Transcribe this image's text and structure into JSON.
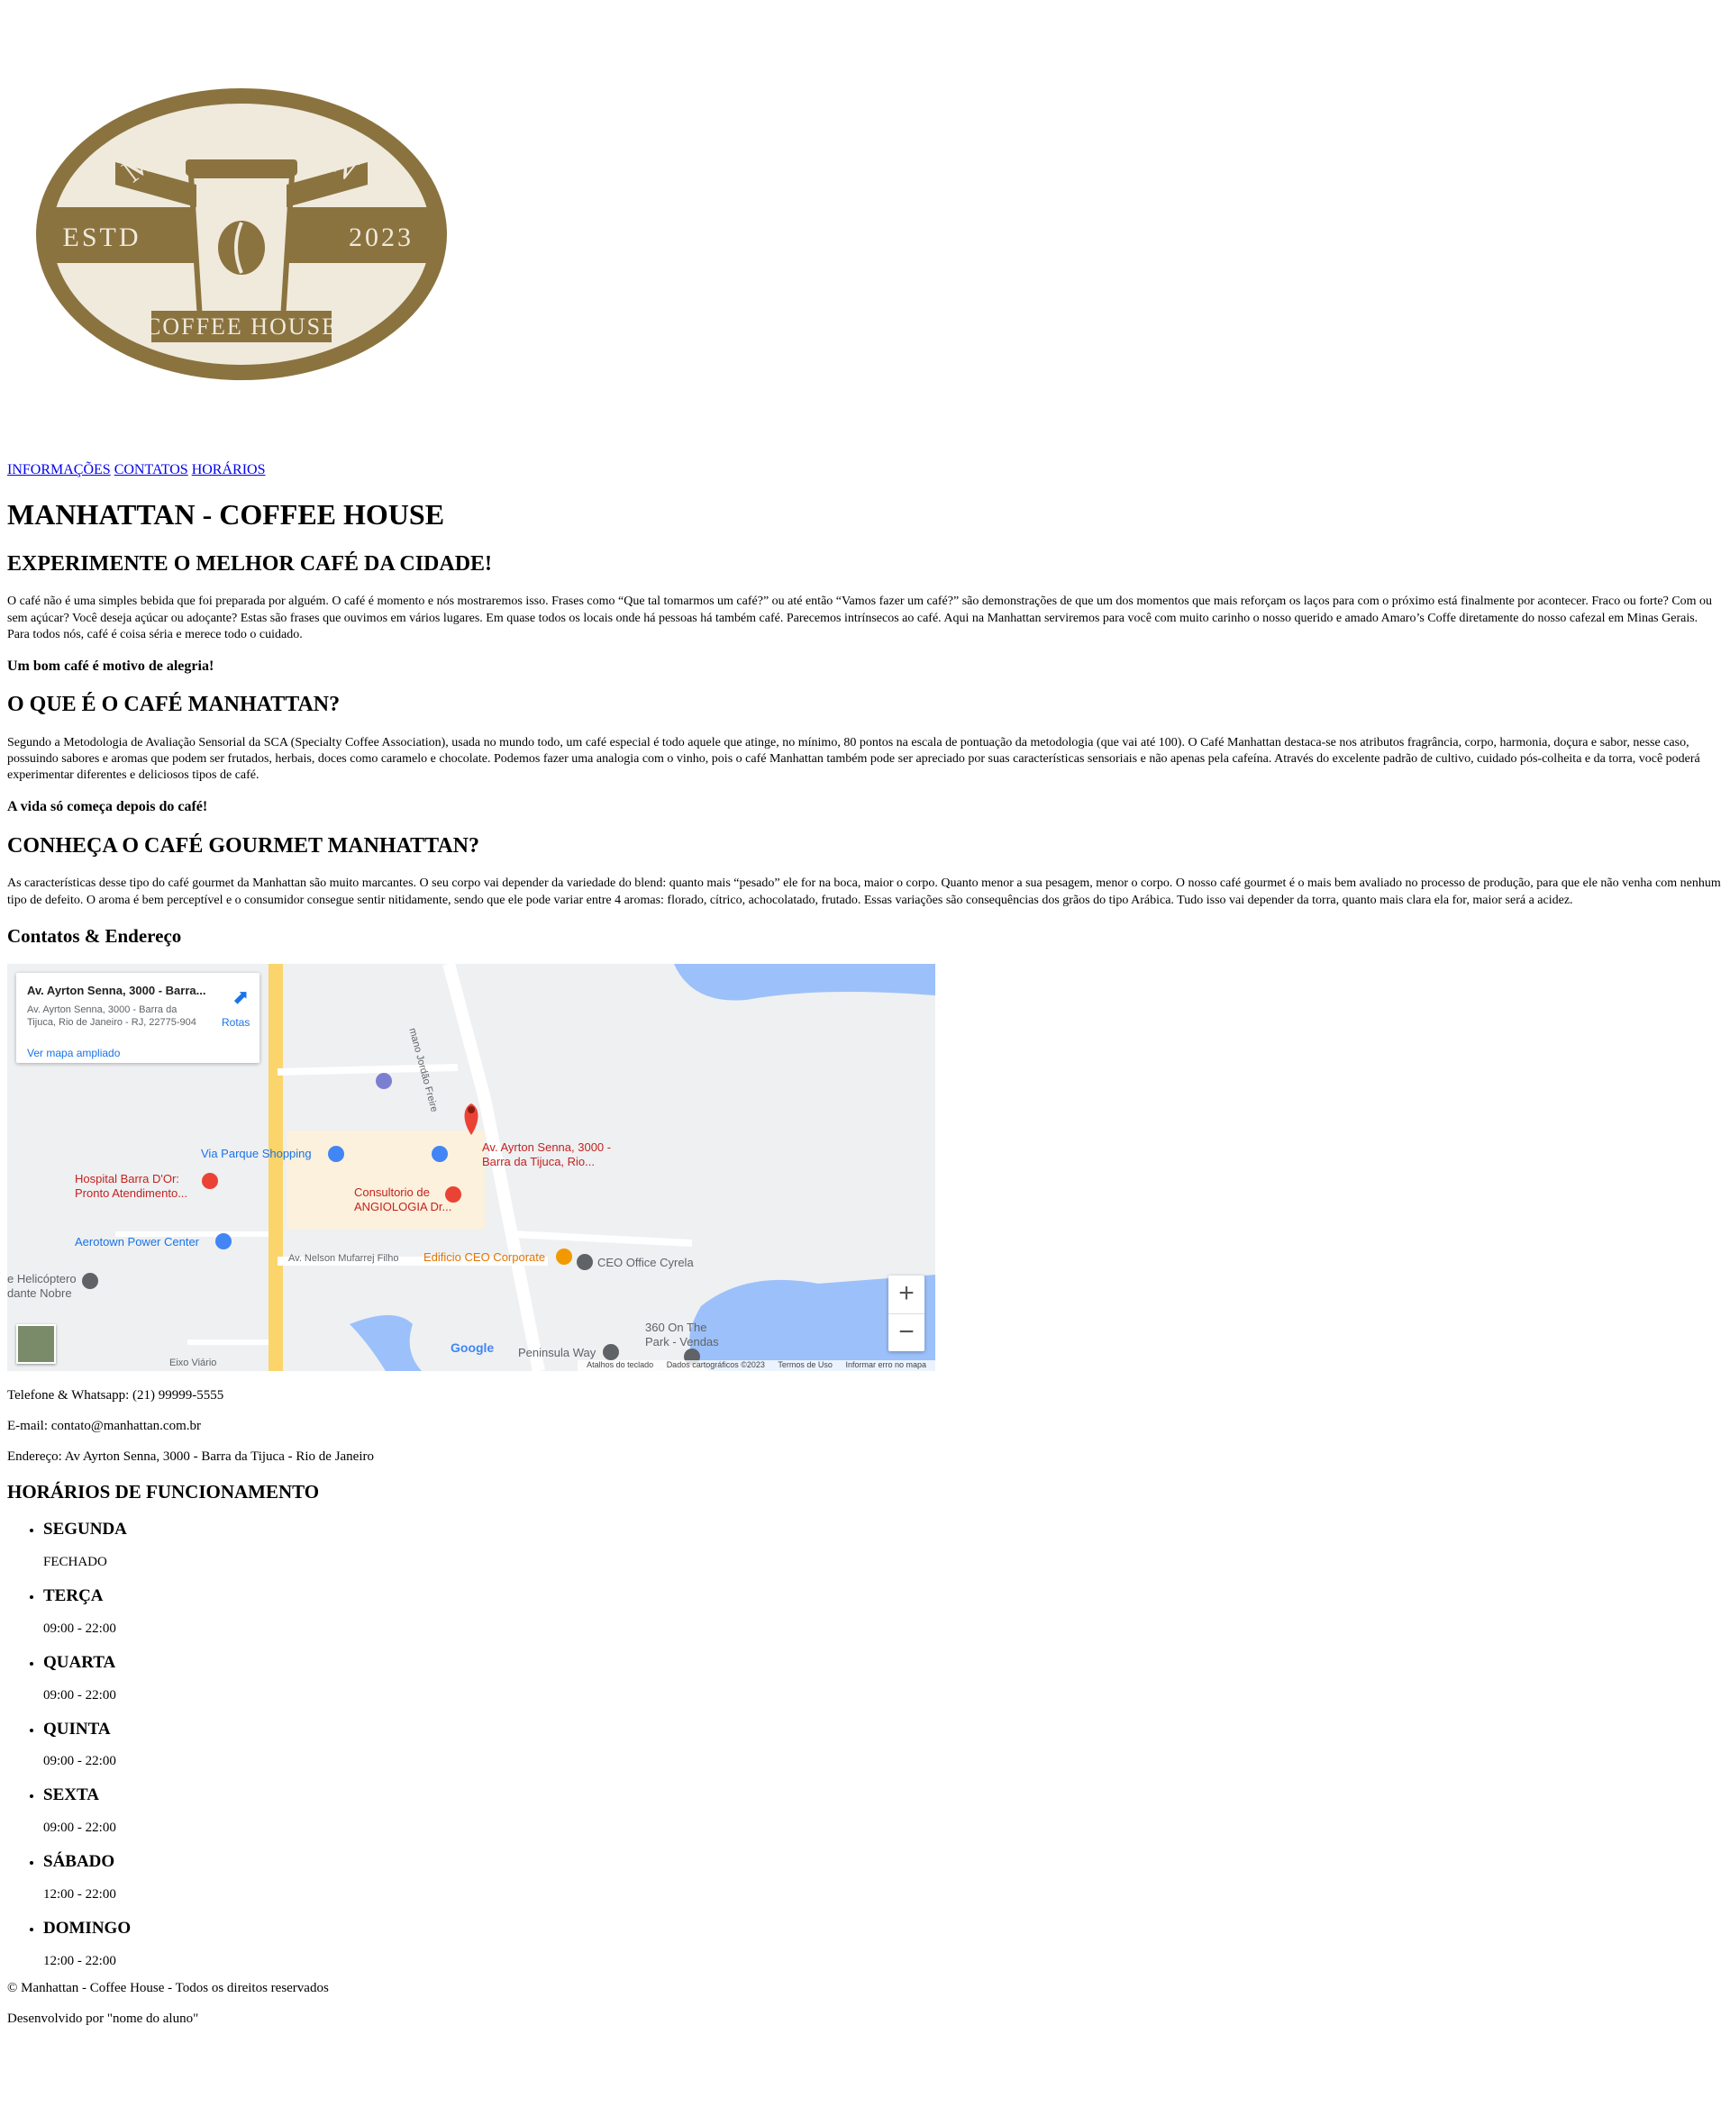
{
  "logo": {
    "top_text": "MANHATTAN",
    "left_text": "ESTD",
    "right_text": "2023",
    "bottom_text": "COFFEE HOUSE"
  },
  "nav": {
    "items": [
      "INFORMAÇÕES",
      "CONTATOS",
      "HORÁRIOS"
    ]
  },
  "main": {
    "title": "MANHATTAN - COFFEE HOUSE",
    "section1": {
      "heading": "EXPERIMENTE O MELHOR CAFÉ DA CIDADE!",
      "body": "O café não é uma simples bebida que foi preparada por alguém. O café é momento e nós mostraremos isso. Frases como “Que tal tomarmos um café?” ou até então “Vamos fazer um café?” são demonstrações de que um dos momentos que mais reforçam os laços para com o próximo está finalmente por acontecer. Fraco ou forte? Com ou sem açúcar? Você deseja açúcar ou adoçante? Estas são frases que ouvimos em vários lugares. Em quase todos os locais onde há pessoas há também café. Parecemos intrínsecos ao café. Aqui na Manhattan serviremos para você com muito carinho o nosso querido e amado Amaro’s Coffe diretamente do nosso cafezal em Minas Gerais. Para todos nós, café é coisa séria e merece todo o cuidado.",
      "tagline": "Um bom café é motivo de alegria!"
    },
    "section2": {
      "heading": "O QUE É O CAFÉ MANHATTAN?",
      "body": "Segundo a Metodologia de Avaliação Sensorial da SCA (Specialty Coffee Association), usada no mundo todo, um café especial é todo aquele que atinge, no mínimo, 80 pontos na escala de pontuação da metodologia (que vai até 100). O Café Manhattan destaca-se nos atributos fragrância, corpo, harmonia, doçura e sabor, nesse caso, possuindo sabores e aromas que podem ser frutados, herbais, doces como caramelo e chocolate. Podemos fazer uma analogia com o vinho, pois o café Manhattan também pode ser apreciado por suas características sensoriais e não apenas pela cafeína. Através do excelente padrão de cultivo, cuidado pós-colheita e da torra, você poderá experimentar diferentes e deliciosos tipos de café.",
      "tagline": "A vida só começa depois do café!"
    },
    "section3": {
      "heading": "CONHEÇA O CAFÉ GOURMET MANHATTAN?",
      "body": "As características desse tipo do café gourmet da Manhattan são muito marcantes. O seu corpo vai depender da variedade do blend: quanto mais “pesado” ele for na boca, maior o corpo. Quanto menor a sua pesagem, menor o corpo. O nosso café gourmet é o mais bem avaliado no processo de produção, para que ele não venha com nenhum tipo de defeito. O aroma é bem perceptível e o consumidor consegue sentir nitidamente, sendo que ele pode variar entre 4 aromas: florado, cítrico, achocolatado, frutado. Essas variações são consequências dos grãos do tipo Arábica. Tudo isso vai depender da torra, quanto mais clara ela for, maior será a acidez."
    }
  },
  "contacts": {
    "heading": "Contatos & Endereço",
    "map": {
      "card_title": "Av. Ayrton Senna, 3000 - Barra...",
      "card_address": "Av. Ayrton Senna, 3000 - Barra da Tijuca, Rio de Janeiro - RJ, 22775-904",
      "card_link": "Ver mapa ampliado",
      "directions": "Rotas",
      "pin_label": "Av. Ayrton Senna, 3000 - Barra da Tijuca, Rio...",
      "places": [
        "Via Parque Shopping",
        "Hospital Barra D'Or: Pronto Atendimento...",
        "Consultorio de ANGIOLOGIA Dr...",
        "Aerotown Power Center",
        "Av. Nelson Mufarrej Filho",
        "Edificio CEO Corporate",
        "CEO Office Cyrela",
        "e Helicóptero dante Nobre",
        "360 On The Park - Vendas",
        "Peninsula Way",
        "Eixo Viário",
        "mano Jordão Freire"
      ],
      "zoom_in": "+",
      "zoom_out": "−",
      "google": "Google",
      "attribution": [
        "Atalhos do teclado",
        "Dados cartográficos ©2023",
        "Termos de Uso",
        "Informar erro no mapa"
      ]
    },
    "phone": "Telefone & Whatsapp: (21) 99999-5555",
    "email": "E-mail: contato@manhattan.com.br",
    "address": "Endereço: Av Ayrton Senna, 3000 - Barra da Tijuca - Rio de Janeiro"
  },
  "hours": {
    "heading": "HORÁRIOS DE FUNCIONAMENTO",
    "days": [
      {
        "day": "SEGUNDA",
        "time": "FECHADO"
      },
      {
        "day": "TERÇA",
        "time": "09:00 - 22:00"
      },
      {
        "day": "QUARTA",
        "time": "09:00 - 22:00"
      },
      {
        "day": "QUINTA",
        "time": "09:00 - 22:00"
      },
      {
        "day": "SEXTA",
        "time": "09:00 - 22:00"
      },
      {
        "day": "SÁBADO",
        "time": "12:00 - 22:00"
      },
      {
        "day": "DOMINGO",
        "time": "12:00 - 22:00"
      }
    ]
  },
  "footer": {
    "copyright": "© Manhattan - Coffee House - Todos os direitos reservados",
    "credit": "Desenvolvido por \"nome do aluno\""
  },
  "colors": {
    "logo_brown": "#8b7340",
    "logo_cream": "#efeadc",
    "link": "#0000ee",
    "map_water": "#9cc0f9",
    "map_road": "#fbd56b",
    "map_pin": "#ea4335"
  }
}
